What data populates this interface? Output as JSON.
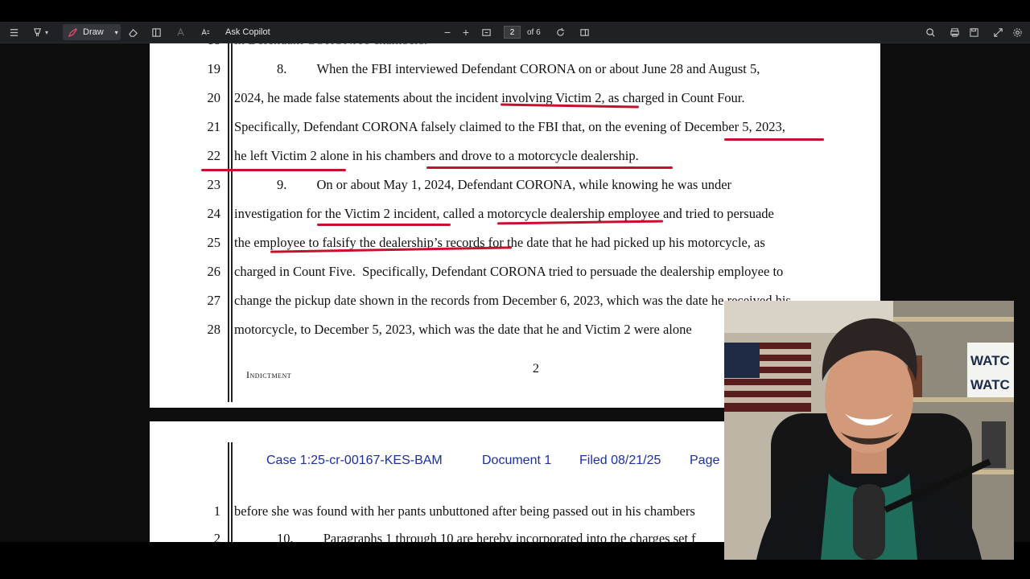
{
  "toolbar": {
    "draw_label": "Draw",
    "copilot_label": "Ask Copilot",
    "page_current": "2",
    "page_total": "of 6"
  },
  "page1": {
    "lines": [
      {
        "num": "19",
        "text": "8.         When the FBI interviewed Defendant CORONA on or about June 28 and August 5,"
      },
      {
        "num": "20",
        "text": "2024, he made false statements about the incident involving Victim 2, as charged in Count Four."
      },
      {
        "num": "21",
        "text": "Specifically, Defendant CORONA falsely claimed to the FBI that, on the evening of December 5, 2023,"
      },
      {
        "num": "22",
        "text": "he left Victim 2 alone in his chambers and drove to a motorcycle dealership."
      },
      {
        "num": "23",
        "text": "9.         On or about May 1, 2024, Defendant CORONA, while knowing he was under"
      },
      {
        "num": "24",
        "text": "investigation for the Victim 2 incident, called a motorcycle dealership employee and tried to persuade"
      },
      {
        "num": "25",
        "text": "the employee to falsify the dealership’s records for the date that he had picked up his motorcycle, as"
      },
      {
        "num": "26",
        "text": "charged in Count Five.  Specifically, Defendant CORONA tried to persuade the dealership employee to"
      },
      {
        "num": "27",
        "text": "change the pickup date shown in the records from December 6, 2023, which was the date he received his"
      },
      {
        "num": "28",
        "text": "motorcycle, to December 5, 2023, which was the date that he and Victim 2 were alone"
      }
    ],
    "footer_label": "Indictment",
    "page_number": "2"
  },
  "page2": {
    "case_number": "Case 1:25-cr-00167-KES-BAM",
    "document": "Document 1",
    "filed": "Filed 08/21/25",
    "page_label": "Page",
    "lines": [
      {
        "num": "1",
        "text": "before she was found with her pants unbuttoned after being passed out in his chambers"
      },
      {
        "num": "2",
        "text": "10.         Paragraphs 1 through 10 are hereby incorporated into the charges set f"
      }
    ]
  },
  "webcam": {
    "sign_line1": "WATC",
    "sign_line2": "WATC"
  },
  "colors": {
    "annotation_red": "#c8102e",
    "header_blue": "#1a2fa0"
  }
}
